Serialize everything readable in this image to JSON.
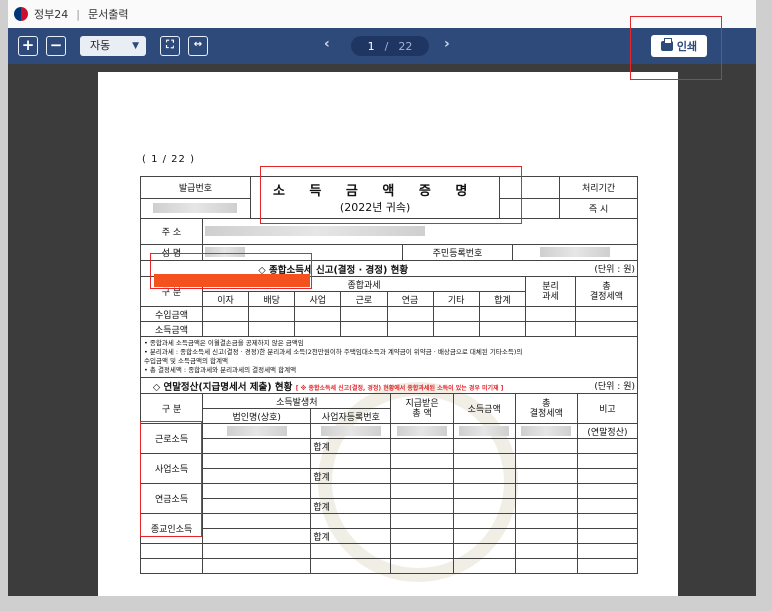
{
  "titlebar": {
    "app": "정부24",
    "title": "문서출력"
  },
  "toolbar": {
    "zoom_in": "+",
    "zoom_out": "−",
    "zoom_value": "자동",
    "prev": "‹",
    "next": "›",
    "current_page": "1",
    "page_sep": "/",
    "total_pages": "22",
    "print_label": "인쇄"
  },
  "document": {
    "page_indicator": "( 1 / 22 )",
    "header": {
      "issue_no_label": "발급번호",
      "title": "소 득 금 액 증 명",
      "subtitle": "(2022년 귀속)",
      "period_label": "처리기간",
      "period_value": "즉 시"
    },
    "address_label": "주 소",
    "name_label": "성 명",
    "rrn_label": "주민등록번호",
    "section1": {
      "title": "◇ 종합소득세 신고(결정 · 경정) 현황",
      "unit": "(단위 : 원)",
      "col_gubun": "구 분",
      "col_comprehensive": "종합과세",
      "col_separate": "분리\n과세",
      "col_total": "총\n결정세액",
      "sub_cols": [
        "이자",
        "배당",
        "사업",
        "근로",
        "연금",
        "기타",
        "합계"
      ],
      "rows": [
        "수입금액",
        "소득금액"
      ],
      "notes": [
        "• 종합과세 소득금액은 이월결손금을 공제하지 않은 금액임",
        "• 분리과세 : 종합소득세 신고(결정 · 경정)한 분리과세 소득(2천만원이하 주택임대소득과 계약금이 위약금 · 배상금으로 대체된 기타소득)의",
        "  수입금액 및 소득금액의 합계액",
        "• 총 결정세액 : 종합과세와 분리과세의 결정세액 합계액"
      ]
    },
    "section2": {
      "title": "◇ 연말정산(지급명세서 제출) 현황",
      "red_note": "[ ※ 종합소득세 신고(결정, 경정) 현황에서 종합과세된 소득이 있는 경우 미기재 ]",
      "unit": "(단위 : 원)",
      "col_gubun": "구 분",
      "col_payer": "소득발생처",
      "col_corp": "법인명(상호)",
      "col_bizno": "사업자등록번호",
      "col_paid": "지급받은\n총 액",
      "col_income": "소득금액",
      "col_tax": "총\n결정세액",
      "col_note": "비고",
      "note_value": "(연말정산)",
      "total_label": "합계",
      "rows": [
        "근로소득",
        "사업소득",
        "연금소득",
        "종교인소득"
      ]
    }
  }
}
